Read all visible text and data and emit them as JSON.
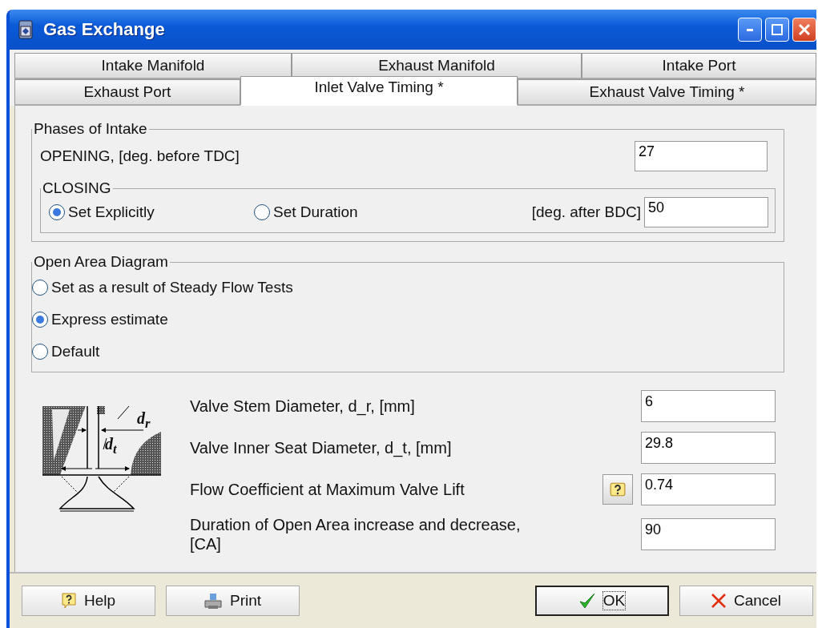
{
  "window": {
    "title": "Gas Exchange"
  },
  "tab_rows": [
    {
      "tabs": [
        {
          "label": "Intake Manifold",
          "selected": false
        },
        {
          "label": "Exhaust Manifold",
          "selected": false
        },
        {
          "label": "Intake Port",
          "selected": false
        }
      ]
    },
    {
      "tabs": [
        {
          "label": "Exhaust Port",
          "selected": false
        },
        {
          "label": "Inlet Valve Timing *",
          "selected": true
        },
        {
          "label": "Exhaust Valve Timing *",
          "selected": false
        }
      ]
    }
  ],
  "phases": {
    "title": "Phases of Intake",
    "opening_label": "OPENING, [deg. before TDC]",
    "opening_value": "27",
    "closing": {
      "title": "CLOSING",
      "options": [
        {
          "label": "Set Explicitly",
          "selected": true
        },
        {
          "label": "Set Duration",
          "selected": false
        }
      ],
      "unit_label": "[deg. after BDC]",
      "value": "50"
    }
  },
  "open_area": {
    "title": "Open Area Diagram",
    "options": [
      {
        "label": "Set as a result of Steady Flow Tests",
        "selected": false
      },
      {
        "label": "Express estimate",
        "selected": true
      },
      {
        "label": "Default",
        "selected": false
      }
    ]
  },
  "diagram": {
    "labels": [
      "d$_{r}$",
      "d$_{t}$"
    ]
  },
  "parameters": [
    {
      "label": "Valve Stem Diameter, d_r, [mm]",
      "value": "6",
      "help": false
    },
    {
      "label": "Valve Inner Seat Diameter, d_t, [mm]",
      "value": "29.8",
      "help": false
    },
    {
      "label": "Flow Coefficient at Maximum Valve Lift",
      "value": "0.74",
      "help": true
    },
    {
      "label": "Duration of Open Area increase and decrease, [CA]",
      "value": "90",
      "help": false
    }
  ],
  "buttons": [
    {
      "label": "Help",
      "kind": "help",
      "default": false
    },
    {
      "label": "Print",
      "kind": "print",
      "default": false
    },
    {
      "label": "OK",
      "kind": "ok",
      "default": true
    },
    {
      "label": "Cancel",
      "kind": "cancel",
      "default": false
    }
  ]
}
